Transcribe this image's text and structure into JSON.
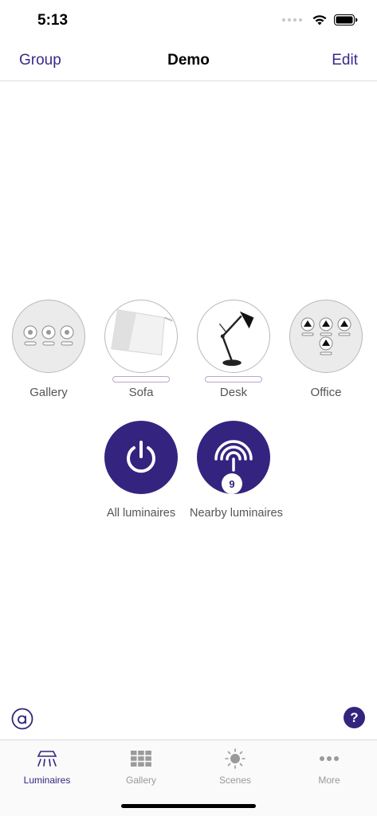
{
  "status_bar": {
    "time": "5:13",
    "icons": [
      "signal-dots",
      "wifi-icon",
      "battery-icon"
    ]
  },
  "nav": {
    "left": "Group",
    "title": "Demo",
    "right": "Edit"
  },
  "luminaires": [
    {
      "label": "Gallery",
      "icon": "gallery-spots-icon"
    },
    {
      "label": "Sofa",
      "icon": "floor-lamp-image"
    },
    {
      "label": "Desk",
      "icon": "desk-lamp-image"
    },
    {
      "label": "Office",
      "icon": "office-pendants-icon"
    }
  ],
  "actions": [
    {
      "label": "All luminaires",
      "icon": "power-icon"
    },
    {
      "label": "Nearby luminaires",
      "icon": "nearby-signal-icon",
      "badge": "9"
    }
  ],
  "help": {
    "label": "?"
  },
  "tabs": [
    {
      "label": "Luminaires",
      "icon": "luminaire-icon",
      "active": true
    },
    {
      "label": "Gallery",
      "icon": "grid-icon",
      "active": false
    },
    {
      "label": "Scenes",
      "icon": "sun-icon",
      "active": false
    },
    {
      "label": "More",
      "icon": "more-dots-icon",
      "active": false
    }
  ],
  "colors": {
    "accent": "#34247f",
    "link": "#3a2a8c",
    "inactive_tab": "#999999"
  }
}
